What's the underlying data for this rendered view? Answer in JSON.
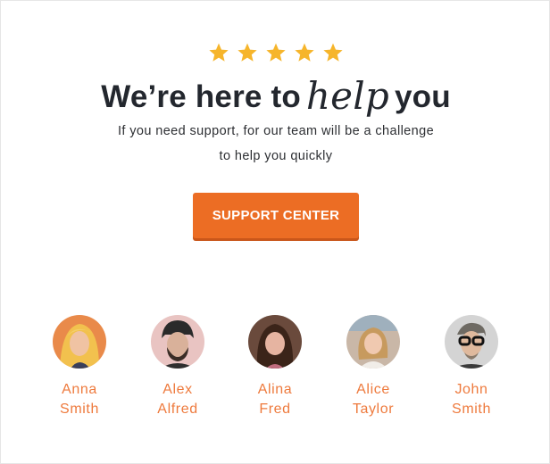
{
  "rating": {
    "stars": 5,
    "star_color": "#f6b52b"
  },
  "headline": {
    "before": "We’re here to",
    "script_word": "help",
    "after": "you"
  },
  "subtitle": {
    "line1": "If you need support, for our team will be a challenge",
    "line2": "to help you quickly"
  },
  "cta": {
    "label": "SUPPORT CENTER",
    "color": "#ec6d24"
  },
  "accent_name_color": "#ee7a3d",
  "team": [
    {
      "first": "Anna",
      "last": "Smith"
    },
    {
      "first": "Alex",
      "last": "Alfred"
    },
    {
      "first": "Alina",
      "last": "Fred"
    },
    {
      "first": "Alice",
      "last": "Taylor"
    },
    {
      "first": "John",
      "last": "Smith"
    }
  ]
}
